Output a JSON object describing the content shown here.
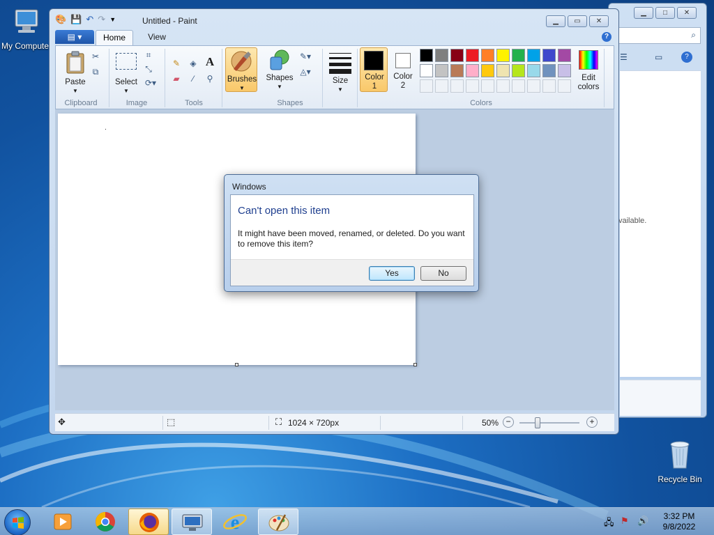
{
  "desktop": {
    "icons": {
      "my_computer": "My Computer",
      "recycle_bin": "Recycle Bin"
    }
  },
  "explorer_bg": {
    "partial_text": "vailable."
  },
  "paint": {
    "title": "Untitled - Paint",
    "tabs": {
      "home": "Home",
      "view": "View"
    },
    "help": "?",
    "groups": {
      "clipboard": "Clipboard",
      "image": "Image",
      "tools": "Tools",
      "shapes": "Shapes",
      "colors": "Colors"
    },
    "buttons": {
      "paste": "Paste",
      "select": "Select",
      "brushes": "Brushes",
      "shapes": "Shapes",
      "size": "Size",
      "color1_line1": "Color",
      "color1_line2": "1",
      "color2_line1": "Color",
      "color2_line2": "2",
      "edit_colors_line1": "Edit",
      "edit_colors_line2": "colors",
      "text_tool": "A"
    },
    "palette_row1": [
      "#000000",
      "#7f7f7f",
      "#880015",
      "#ed1c24",
      "#ff7f27",
      "#fff200",
      "#22b14c",
      "#00a2e8",
      "#3f48cc",
      "#a349a4"
    ],
    "palette_row2": [
      "#ffffff",
      "#c3c3c3",
      "#b97a57",
      "#ffaec9",
      "#ffc90e",
      "#efe4b0",
      "#b5e61d",
      "#99d9ea",
      "#7092be",
      "#c8bfe7"
    ],
    "color1": "#000000",
    "color2": "#ffffff",
    "status": {
      "dimensions": "1024 × 720px",
      "zoom": "50%",
      "zoom_fraction": 0.5
    }
  },
  "dialog": {
    "title": "Windows",
    "heading": "Can't open this item",
    "message": "It might have been moved, renamed, or deleted. Do you want to remove this item?",
    "yes": "Yes",
    "no": "No"
  },
  "taskbar": {
    "time": "3:32 PM",
    "date": "9/8/2022"
  }
}
